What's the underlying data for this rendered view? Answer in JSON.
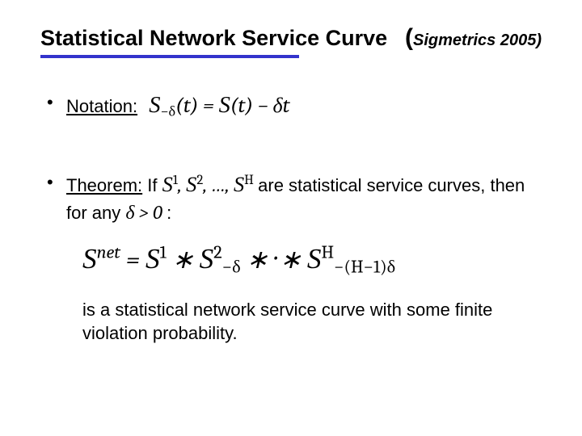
{
  "title": "Statistical Network Service Curve",
  "citation_label": "Sigmetrics 2005)",
  "bullets": {
    "notation": {
      "label": "Notation:",
      "math_lhs_S": "S",
      "math_sub": "−δ",
      "math_arg": "(t)",
      "math_eq": " = ",
      "math_rhs_S": "S",
      "math_rhs_arg": "(t)",
      "math_minus": " − ",
      "math_dt": "δt"
    },
    "theorem": {
      "label": "Theorem:",
      "if_word": " If ",
      "s_sym": "S",
      "sup1": "1",
      "comma": ", ",
      "sup2": "2",
      "dots": ", …, ",
      "supH": "H",
      "are_text": "   are statistical service curves, then for any ",
      "delta_cond": "δ > 0",
      "colon": " :"
    }
  },
  "display": {
    "Snet": "S",
    "net_sup": "net",
    "eq": "  =  ",
    "s1_sup": "1",
    "star": " ∗ ",
    "s2_sup": "2",
    "s2_sub": "−δ",
    "cdots": " ∗ ··· ∗ ",
    "sH_sup": "H",
    "sH_sub": "−(H−1)δ"
  },
  "conclusion": "is a statistical network service curve with some finite violation probability."
}
